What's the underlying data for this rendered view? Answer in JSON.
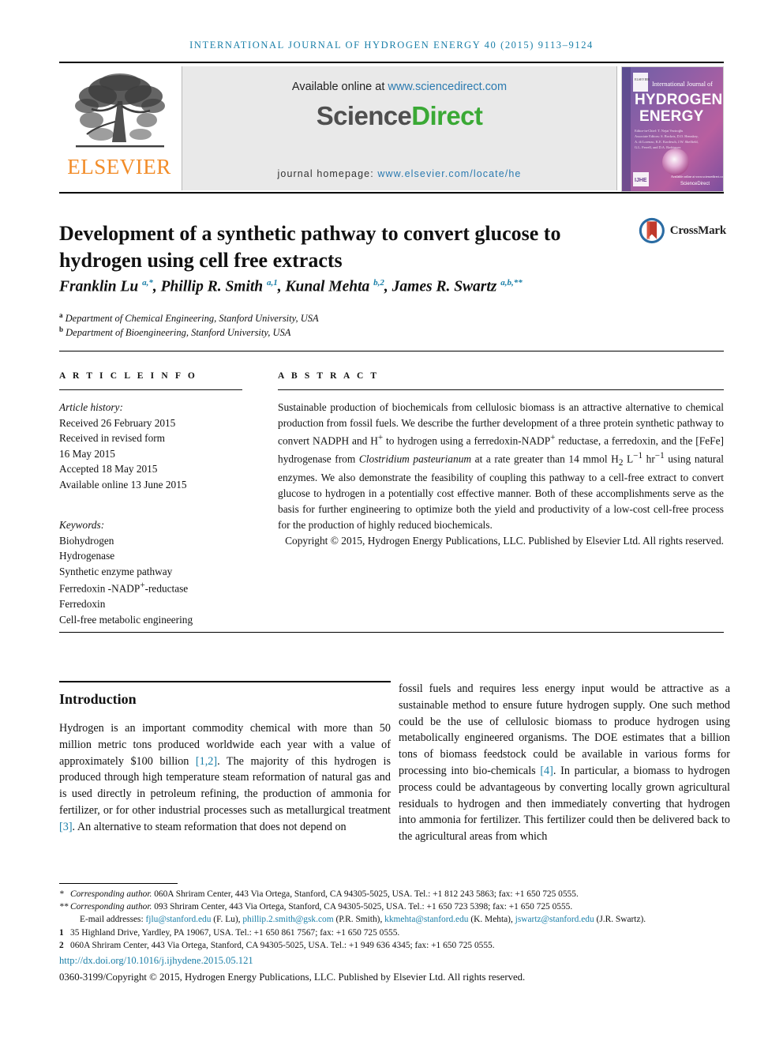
{
  "running_head": "INTERNATIONAL JOURNAL OF HYDROGEN ENERGY 40 (2015) 9113–9124",
  "masthead": {
    "publisher_name": "ELSEVIER",
    "available_text": "Available online at",
    "available_url": "www.sciencedirect.com",
    "sciencedirect_part1": "Science",
    "sciencedirect_part2": "Direct",
    "homepage_label": "journal homepage:",
    "homepage_url": "www.elsevier.com/locate/he",
    "cover": {
      "line1": "International Journal of",
      "line2": "HYDROGEN",
      "line3": "ENERGY",
      "editor_label": "Editor-in-Chief:",
      "editor_name": "T. Nejat Veziroğlu",
      "assoc_label": "Associate Editors:",
      "assoc_names": "S. Bockris, D.O. Hemskey, A. di Lorenzo, K.E. Kordesch, J.W. Sheffield, G.L. Ferrell, and D.A. Rodriguez",
      "badge": "IJHE",
      "footer": "Available online at www.sciencedirect.com"
    }
  },
  "article": {
    "title": "Development of a synthetic pathway to convert glucose to hydrogen using cell free extracts",
    "crossmark_label": "CrossMark",
    "authors_html": "Franklin Lu <sup>a,*</sup>, Phillip R. Smith <sup>a,1</sup>, Kunal Mehta <sup>b,2</sup>, James R. Swartz <sup>a,b,**</sup>",
    "affiliation_a": "Department of Chemical Engineering, Stanford University, USA",
    "affiliation_b": "Department of Bioengineering, Stanford University, USA",
    "affiliation_a_mark": "a",
    "affiliation_b_mark": "b"
  },
  "article_info": {
    "heading": "A R T I C L E   I N F O",
    "history_label": "Article history:",
    "history": [
      "Received 26 February 2015",
      "Received in revised form",
      "16 May 2015",
      "Accepted 18 May 2015",
      "Available online 13 June 2015"
    ],
    "keywords_label": "Keywords:",
    "keywords": [
      "Biohydrogen",
      "Hydrogenase",
      "Synthetic enzyme pathway",
      "Ferredoxin-NADP+-reductase",
      "Ferredoxin",
      "Cell-free metabolic engineering"
    ]
  },
  "abstract": {
    "heading": "A B S T R A C T",
    "body_html": "Sustainable production of biochemicals from cellulosic biomass is an attractive alternative to chemical production from fossil fuels. We describe the further development of a three protein synthetic pathway to convert NADPH and H<sup>+</sup> to hydrogen using a ferredoxin-NADP<sup>+</sup> reductase, a ferredoxin, and the [FeFe] hydrogenase from <i>Clostridium pasteurianum</i> at a rate greater than 14&nbsp;mmol H<sub>2</sub> L<sup>−1</sup> hr<sup>−1</sup> using natural enzymes. We also demonstrate the feasibility of coupling this pathway to a cell-free extract to convert glucose to hydrogen in a potentially cost effective manner. Both of these accomplishments serve as the basis for further engineering to optimize both the yield and productivity of a low-cost cell-free process for the production of highly reduced biochemicals.",
    "copyright_html": "Copyright © 2015, Hydrogen Energy Publications, LLC. Published by Elsevier Ltd. All rights reserved."
  },
  "introduction": {
    "heading": "Introduction",
    "left_html": "Hydrogen is an important commodity chemical with more than 50 million metric tons produced worldwide each year with a value of approximately $100 billion <span class=\"ref\">[1,2]</span>. The majority of this hydrogen is produced through high temperature steam reformation of natural gas and is used directly in petroleum refining, the production of ammonia for fertilizer, or for other industrial processes such as metallurgical treatment <span class=\"ref\">[3]</span>. An alternative to steam reformation that does not depend on",
    "right_html": "fossil fuels and requires less energy input would be attractive as a sustainable method to ensure future hydrogen supply. One such method could be the use of cellulosic biomass to produce hydrogen using metabolically engineered organisms. The DOE estimates that a billion tons of biomass feedstock could be available in various forms for processing into bio-chemicals <span class=\"ref\">[4]</span>. In particular, a biomass to hydrogen process could be advantageous by converting locally grown agricultural residuals to hydrogen and then immediately converting that hydrogen into ammonia for fertilizer. This fertilizer could then be delivered back to the agricultural areas from which"
  },
  "footnotes": {
    "corresponding_1_mark": "*",
    "corresponding_1_html": "<i>Corresponding author.</i> 060A Shriram Center, 443 Via Ortega, Stanford, CA 94305-5025, USA. Tel.: +1 812 243 5863; fax: +1 650 725 0555.",
    "corresponding_2_mark": "**",
    "corresponding_2_html": "<i>Corresponding author.</i> 093 Shriram Center, 443 Via Ortega, Stanford, CA 94305-5025, USA. Tel.: +1 650 723 5398; fax: +1 650 725 0555.",
    "emails_html": "E-mail addresses: <span class=\"mail\">fjlu@stanford.edu</span> (F. Lu), <span class=\"mail\">phillip.2.smith@gsk.com</span> (P.R. Smith), <span class=\"mail\">kkmehta@stanford.edu</span> (K. Mehta), <span class=\"mail\">jswartz@stanford.edu</span> (J.R. Swartz).",
    "note_1_mark": "1",
    "note_1_html": "35 Highland Drive, Yardley, PA 19067, USA. Tel.: +1 650 861 7567; fax: +1 650 725 0555.",
    "note_2_mark": "2",
    "note_2_html": "060A Shriram Center, 443 Via Ortega, Stanford, CA 94305-5025, USA. Tel.: +1 949 636 4345; fax: +1 650 725 0555.",
    "doi": "http://dx.doi.org/10.1016/j.ijhydene.2015.05.121",
    "issn_copyright_html": "0360-3199/Copyright © 2015, Hydrogen Energy Publications, LLC. Published by Elsevier Ltd. All rights reserved."
  },
  "colors": {
    "accent_blue": "#1a7fa8",
    "link_blue": "#2a7ab0",
    "elsevier_orange": "#F28C28",
    "sciencedirect_green": "#3aa935",
    "band_gray": "#e9e9e9"
  }
}
